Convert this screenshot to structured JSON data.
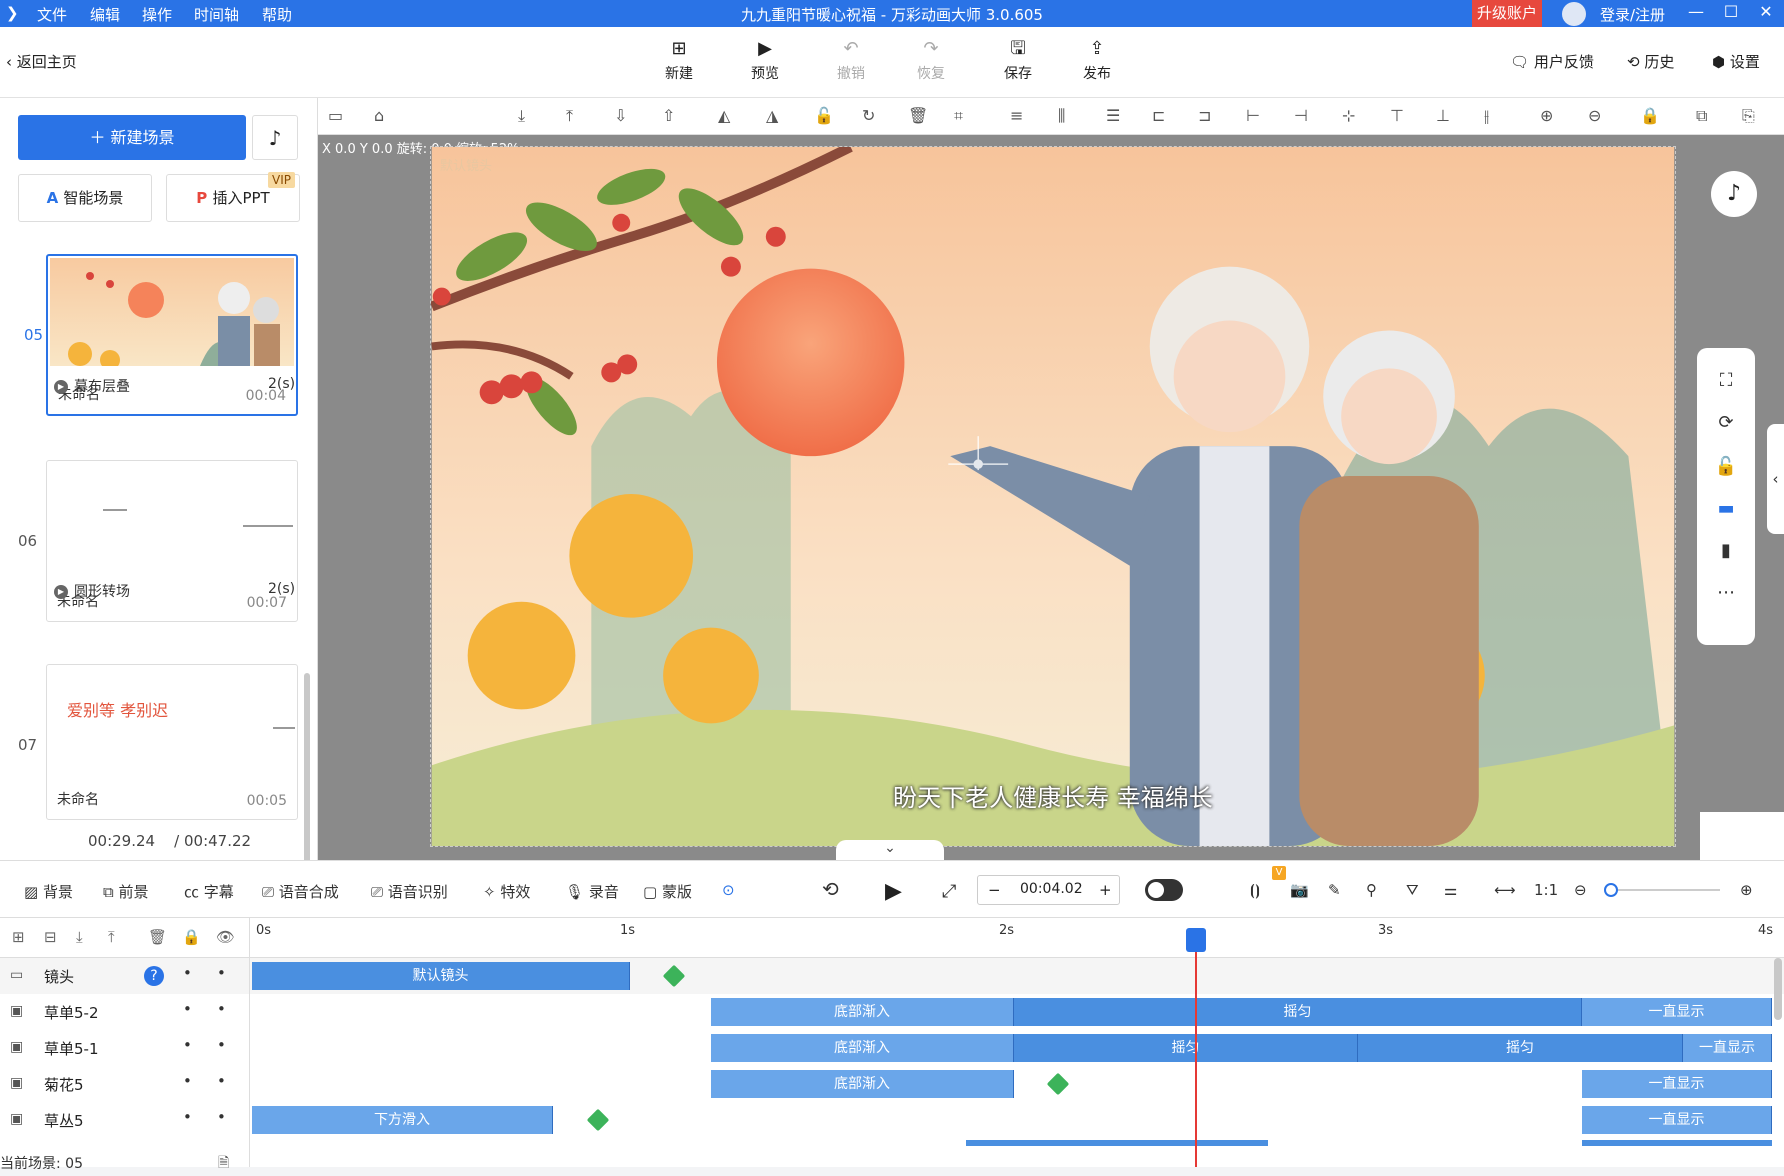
{
  "title_bar": {
    "menu": [
      "文件",
      "编辑",
      "操作",
      "时间轴",
      "帮助"
    ],
    "title": "九九重阳节暖心祝福 - 万彩动画大师 3.0.605",
    "upgrade": "升级账户",
    "login": "登录/注册",
    "accent_color": "#2a73e6"
  },
  "toolbar": {
    "back": "返回主页",
    "buttons": [
      {
        "label": "新建",
        "icon": "plus-box-icon"
      },
      {
        "label": "预览",
        "icon": "play-icon"
      },
      {
        "label": "撤销",
        "icon": "undo-icon"
      },
      {
        "label": "恢复",
        "icon": "redo-icon"
      },
      {
        "label": "保存",
        "icon": "save-icon"
      },
      {
        "label": "发布",
        "icon": "publish-icon"
      }
    ],
    "right": [
      "用户反馈",
      "历史",
      "设置"
    ]
  },
  "left_panel": {
    "new_scene": "新建场景",
    "smart_scene": "智能场景",
    "insert_ppt": "插入PPT",
    "vip": "VIP",
    "scenes": [
      {
        "num": "05",
        "name": "未命名",
        "time": "00:04",
        "selected": true
      },
      {
        "num": "06",
        "name": "未命名",
        "time": "00:07",
        "selected": false
      },
      {
        "num": "07",
        "name": "未命名",
        "time": "00:05",
        "selected": false,
        "text": "爱别等 孝别迟"
      }
    ],
    "transitions": [
      {
        "name": "幕布层叠",
        "duration": "2(s)"
      },
      {
        "name": "圆形转场",
        "duration": "2(s)"
      }
    ],
    "current_time": "00:29.24",
    "total_time": "/ 00:47.22"
  },
  "canvas": {
    "coords": "X 0.0  Y 0.0  旋转: 0.0  缩放: 52%",
    "camera_label": "默认镜头",
    "subtitle": "盼天下老人健康长寿 幸福绵长"
  },
  "bottom_toolbar": {
    "tools": [
      "背景",
      "前景",
      "字幕",
      "语音合成",
      "语音识别",
      "特效",
      "录音",
      "蒙版"
    ],
    "time_value": "00:04.02",
    "vip_badge": "V"
  },
  "timeline": {
    "ticks": [
      "0s",
      "1s",
      "2s",
      "3s",
      "4s"
    ],
    "rows": [
      {
        "name": "镜头",
        "clips": [
          {
            "label": "默认镜头"
          }
        ]
      },
      {
        "name": "草单5-2",
        "clips": [
          {
            "label": "底部渐入"
          },
          {
            "label": "摇匀"
          },
          {
            "label": "一直显示"
          }
        ]
      },
      {
        "name": "草单5-1",
        "clips": [
          {
            "label": "底部渐入"
          },
          {
            "label": "摇匀"
          },
          {
            "label": "摇匀"
          },
          {
            "label": "一直显示"
          }
        ]
      },
      {
        "name": "菊花5",
        "clips": [
          {
            "label": "底部渐入"
          },
          {
            "label": "一直显示"
          }
        ]
      },
      {
        "name": "草丛5",
        "clips": [
          {
            "label": "下方滑入"
          },
          {
            "label": "一直显示"
          }
        ]
      }
    ],
    "current_scene": "当前场景: 05",
    "help": "?",
    "playhead_time_s": 2.5
  }
}
